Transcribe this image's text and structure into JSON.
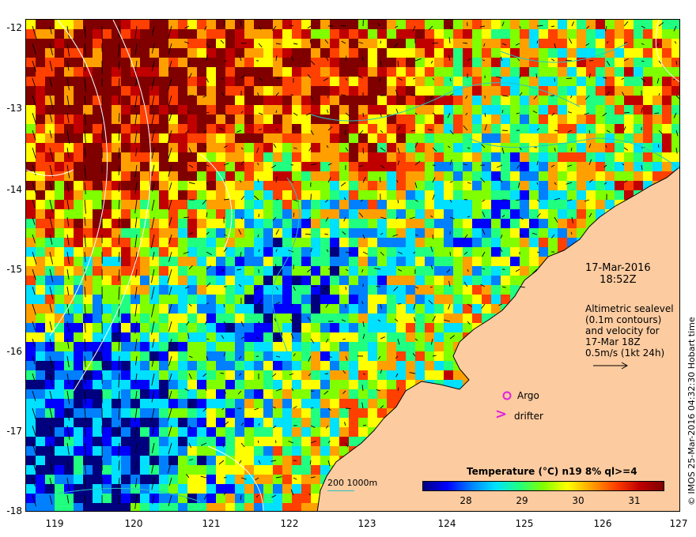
{
  "map": {
    "date_line1": "17-Mar-2016",
    "date_line2": "18:52Z",
    "altimetry_lines": [
      "Altimetric sealevel",
      "(0.1m contours)",
      "and velocity for",
      "17-Mar 18Z",
      "0.5m/s (1kt 24h)"
    ],
    "argo_label": "Argo",
    "drifter_label": "drifter",
    "drifter_symbol": ">",
    "copyright": "© IMOS 25-Mar-2016 04:32:30 Hobart time",
    "depth_legend": "200  1000m",
    "latitude_labels": [
      "-12",
      "-13",
      "-14",
      "-15",
      "-16",
      "-17",
      "-18"
    ],
    "longitude_labels": [
      "119",
      "120",
      "121",
      "122",
      "123",
      "124",
      "125",
      "126",
      "127"
    ],
    "colors": {
      "land": "#fccba0",
      "coast": "#000000",
      "depth_contour": "#27c4c4",
      "marker": "#e020e0"
    }
  },
  "colorbar": {
    "title": "Temperature (°C) n19 8% ql>=4",
    "ticks": [
      "28",
      "29",
      "30",
      "31"
    ],
    "range": [
      27.3,
      31.6
    ],
    "colors": [
      "#00007f",
      "#0000ff",
      "#0080ff",
      "#00e0ff",
      "#20ff80",
      "#80ff00",
      "#ffff00",
      "#ffa000",
      "#ff4000",
      "#c00000",
      "#800000"
    ]
  }
}
